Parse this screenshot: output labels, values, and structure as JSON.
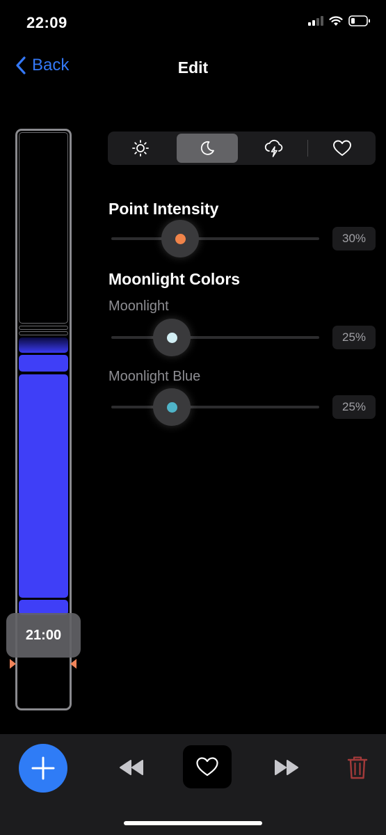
{
  "status_bar": {
    "time": "22:09",
    "icons": [
      "cellular-signal-icon",
      "wifi-icon",
      "battery-icon"
    ]
  },
  "nav": {
    "back_label": "Back",
    "title": "Edit"
  },
  "timeline": {
    "current_time": "21:00"
  },
  "segments": [
    {
      "icon": "sun-icon",
      "active": false
    },
    {
      "icon": "moon-icon",
      "active": true
    },
    {
      "icon": "lightning-cloud-icon",
      "active": false
    },
    {
      "icon": "heart-icon",
      "active": false
    }
  ],
  "point_intensity": {
    "title": "Point Intensity",
    "value": "30%",
    "color": "#f0844a"
  },
  "moonlight_colors": {
    "title": "Moonlight Colors",
    "sliders": [
      {
        "label": "Moonlight",
        "value": "25%",
        "color": "#d2eef4"
      },
      {
        "label": "Moonlight Blue",
        "value": "25%",
        "color": "#4fb4c8"
      }
    ]
  },
  "toolbar": {
    "buttons": [
      "add-icon",
      "rewind-icon",
      "heart-icon",
      "fast-forward-icon",
      "trash-icon"
    ]
  },
  "colors": {
    "accent": "#3478f6",
    "timeline_blue": "#3f3ff7",
    "trash": "#a33a3a"
  }
}
